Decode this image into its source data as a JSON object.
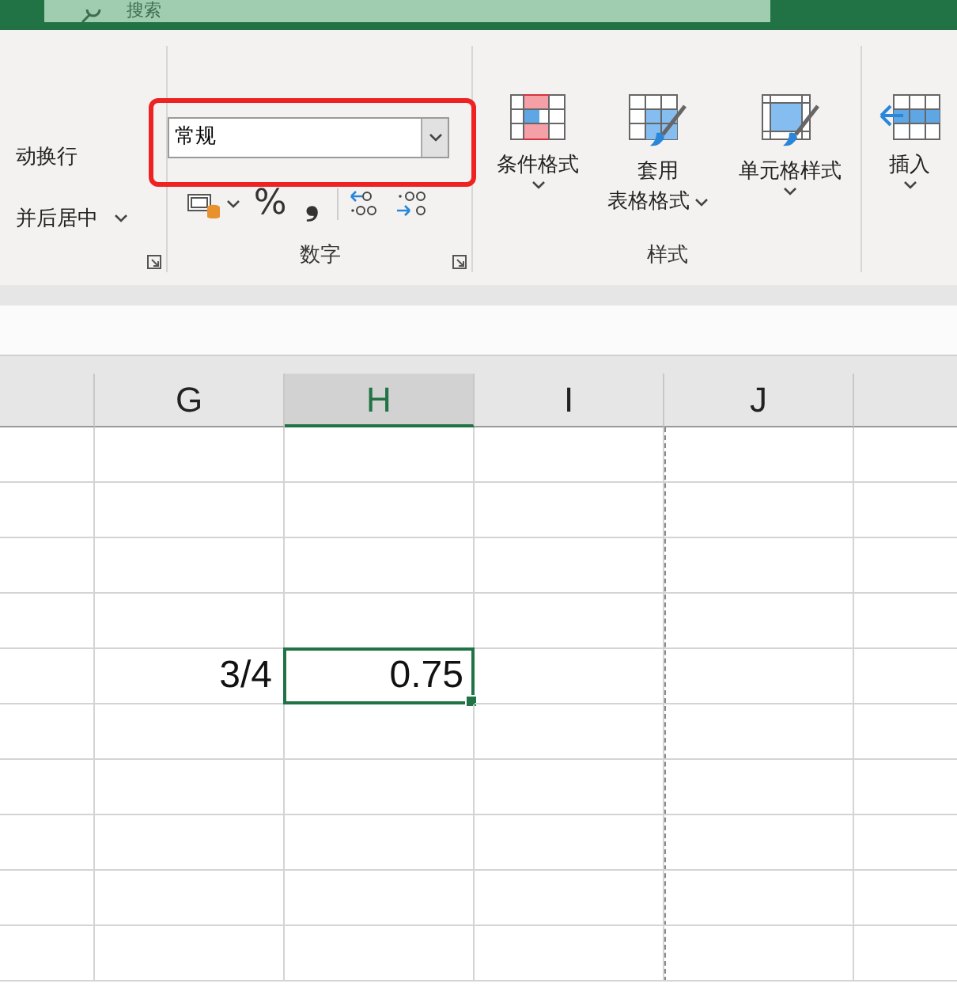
{
  "title_bar": {
    "search": {
      "placeholder": "搜索"
    }
  },
  "ribbon": {
    "alignment_group": {
      "buttons": [
        {
          "label": "动换行",
          "kind": "plain"
        },
        {
          "label": "并后居中",
          "kind": "dropdown"
        }
      ]
    },
    "number_group": {
      "label": "数字",
      "format": {
        "value": "常规",
        "highlighted": true
      },
      "tools": [
        {
          "kind": "currency"
        },
        {
          "kind": "percent",
          "label": "%"
        },
        {
          "kind": "comma",
          "label": "❟"
        },
        {
          "kind": "increase-decimal"
        },
        {
          "kind": "decrease-decimal"
        }
      ]
    },
    "styles_group": {
      "label": "样式",
      "buttons": [
        {
          "kind": "conditional",
          "lines": [
            "条件格式"
          ]
        },
        {
          "kind": "table",
          "lines": [
            "套用",
            "表格格式"
          ]
        },
        {
          "kind": "cell",
          "lines": [
            "单元格样式"
          ]
        }
      ]
    },
    "cells_group": {
      "buttons": [
        {
          "kind": "insert",
          "lines": [
            "插入"
          ]
        }
      ]
    }
  },
  "grid": {
    "columns": [
      {
        "selected": false,
        "page_break_after": false
      },
      {
        "label": "G",
        "selected": false,
        "page_break_after": false
      },
      {
        "label": "H",
        "selected": true,
        "page_break_after": false
      },
      {
        "label": "I",
        "selected": false,
        "page_break_after": true
      },
      {
        "label": "J",
        "selected": false,
        "page_break_after": false
      },
      {
        "selected": false,
        "page_break_after": false
      }
    ],
    "rows": [
      {
        "kind": "empty"
      },
      {
        "kind": "empty"
      },
      {
        "kind": "empty"
      },
      {
        "kind": "empty"
      },
      {
        "kind": "filled",
        "cells": [
          {
            "kind": "blank"
          },
          {
            "kind": "value",
            "text": "3/4",
            "selected": false
          },
          {
            "kind": "value",
            "text": "0.75",
            "selected": true
          },
          {
            "kind": "blank"
          },
          {
            "kind": "blank"
          },
          {
            "kind": "blank"
          }
        ]
      },
      {
        "kind": "empty"
      },
      {
        "kind": "empty"
      },
      {
        "kind": "empty"
      },
      {
        "kind": "empty"
      },
      {
        "kind": "empty"
      }
    ]
  }
}
